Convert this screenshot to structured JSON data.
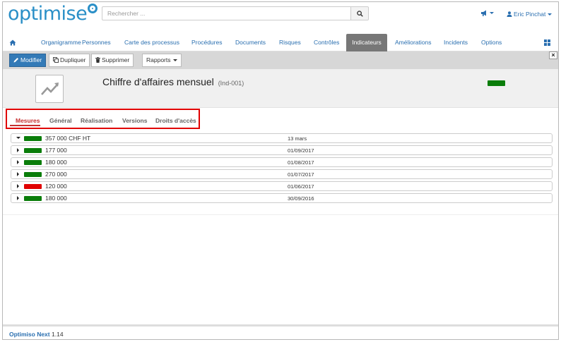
{
  "app": {
    "logo_text": "optimis",
    "logo_tail_letter": "e"
  },
  "search": {
    "placeholder": "Rechercher ..."
  },
  "user": {
    "name": "Eric Pinchat"
  },
  "nav": {
    "items": [
      {
        "label": "Organigramme"
      },
      {
        "label": "Personnes"
      },
      {
        "label": "Carte des processus"
      },
      {
        "label": "Procédures"
      },
      {
        "label": "Documents"
      },
      {
        "label": "Risques"
      },
      {
        "label": "Contrôles"
      },
      {
        "label": "Indicateurs",
        "active": true
      },
      {
        "label": "Améliorations"
      },
      {
        "label": "Incidents"
      },
      {
        "label": "Options"
      }
    ]
  },
  "toolbar": {
    "modify": "Modifier",
    "duplicate": "Dupliquer",
    "delete": "Supprimer",
    "reports": "Rapports",
    "close": "×"
  },
  "indicator": {
    "title": "Chiffre d'affaires mensuel",
    "code": "(Ind-001)",
    "status_color": "#0a7d0a"
  },
  "subtabs": [
    {
      "label": "Mesures",
      "active": true
    },
    {
      "label": "Général"
    },
    {
      "label": "Réalisation"
    },
    {
      "label": "Versions"
    },
    {
      "label": "Droits d'accès"
    }
  ],
  "measures": [
    {
      "value": "357 000 CHF HT",
      "date": "13 mars",
      "status": "#0a7d0a",
      "expanded": true
    },
    {
      "value": "177 000",
      "date": "01/09/2017",
      "status": "#0a7d0a"
    },
    {
      "value": "180 000",
      "date": "01/08/2017",
      "status": "#0a7d0a"
    },
    {
      "value": "270 000",
      "date": "01/07/2017",
      "status": "#0a7d0a"
    },
    {
      "value": "120 000",
      "date": "01/06/2017",
      "status": "#e00000"
    },
    {
      "value": "180 000",
      "date": "30/09/2016",
      "status": "#0a7d0a"
    }
  ],
  "footer": {
    "brand": "Optimiso Next",
    "version": "1.14"
  },
  "colors": {
    "accent": "#2a6fb0",
    "primary_button": "#337ab7",
    "highlight_box": "#e00000",
    "active_tab": "#777777"
  },
  "icons": {
    "home": "home-icon",
    "search": "search-icon",
    "megaphone": "megaphone-icon",
    "user": "user-icon",
    "grid": "grid-icon",
    "pencil": "pencil-icon",
    "copy": "copy-icon",
    "trash": "trash-icon",
    "chart": "line-chart-icon"
  }
}
